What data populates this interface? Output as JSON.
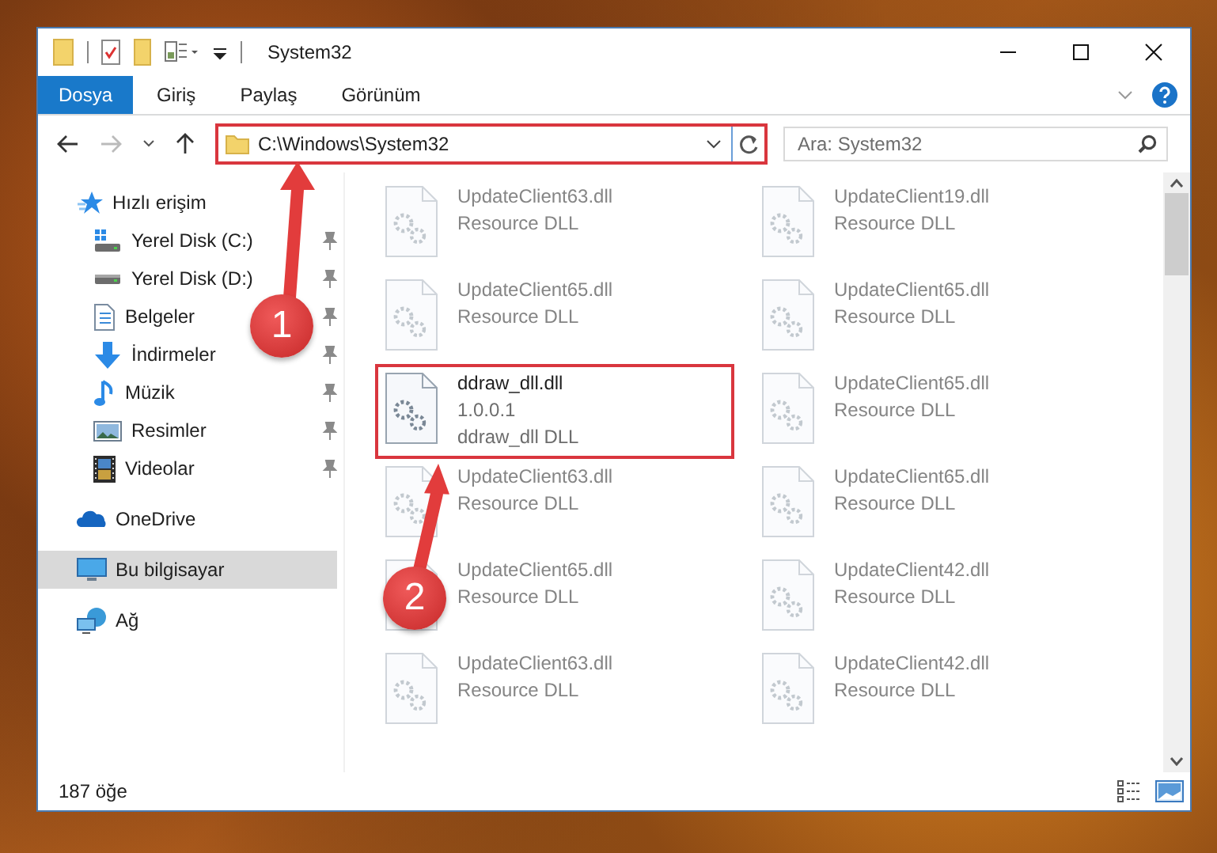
{
  "window": {
    "title": "System32"
  },
  "ribbon": {
    "tabs": [
      {
        "label": "Dosya",
        "selected": true
      },
      {
        "label": "Giriş",
        "selected": false
      },
      {
        "label": "Paylaş",
        "selected": false
      },
      {
        "label": "Görünüm",
        "selected": false
      }
    ]
  },
  "address_bar": {
    "path": "C:\\Windows\\System32",
    "highlighted": true
  },
  "search": {
    "placeholder": "Ara: System32"
  },
  "nav": [
    {
      "label": "Hızlı erişim",
      "selected": false,
      "children": [
        {
          "label": "Yerel Disk (C:)",
          "pinned": true,
          "selected": false
        },
        {
          "label": "Yerel Disk (D:)",
          "pinned": true,
          "selected": false
        },
        {
          "label": "Belgeler",
          "pinned": true,
          "selected": false
        },
        {
          "label": "İndirmeler",
          "pinned": true,
          "selected": false
        },
        {
          "label": "Müzik",
          "pinned": true,
          "selected": false
        },
        {
          "label": "Resimler",
          "pinned": true,
          "selected": false
        },
        {
          "label": "Videolar",
          "pinned": true,
          "selected": false
        }
      ]
    },
    {
      "label": "OneDrive",
      "selected": false
    },
    {
      "label": "Bu bilgisayar",
      "selected": true
    },
    {
      "label": "Ağ",
      "selected": false
    }
  ],
  "files": [
    {
      "name": "UpdateClient63.dll",
      "description": "Resource DLL",
      "highlighted": false
    },
    {
      "name": "UpdateClient19.dll",
      "description": "Resource DLL",
      "highlighted": false
    },
    {
      "name": "UpdateClient65.dll",
      "description": "Resource DLL",
      "highlighted": false
    },
    {
      "name": "UpdateClient65.dll",
      "description": "Resource DLL",
      "highlighted": false
    },
    {
      "name": "ddraw_dll.dll",
      "version": "1.0.0.1",
      "description": "ddraw_dll DLL",
      "highlighted": true
    },
    {
      "name": "UpdateClient65.dll",
      "description": "Resource DLL",
      "highlighted": false
    },
    {
      "name": "UpdateClient63.dll",
      "description": "Resource DLL",
      "highlighted": false
    },
    {
      "name": "UpdateClient65.dll",
      "description": "Resource DLL",
      "highlighted": false
    },
    {
      "name": "UpdateClient65.dll",
      "description": "Resource DLL",
      "highlighted": false
    },
    {
      "name": "UpdateClient42.dll",
      "description": "Resource DLL",
      "highlighted": false
    },
    {
      "name": "UpdateClient63.dll",
      "description": "Resource DLL",
      "highlighted": false
    },
    {
      "name": "UpdateClient42.dll",
      "description": "Resource DLL",
      "highlighted": false
    }
  ],
  "status_bar": {
    "item_count": "187 öğe"
  },
  "callouts": [
    {
      "number": "1"
    },
    {
      "number": "2"
    }
  ]
}
